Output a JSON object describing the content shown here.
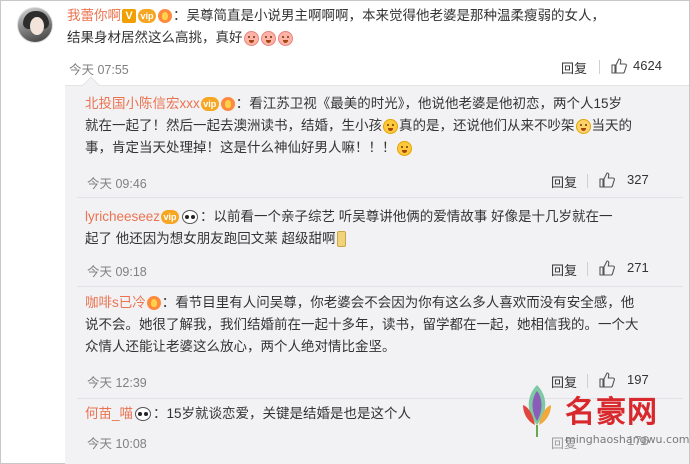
{
  "comments": [
    {
      "username": "我蕾你啊",
      "text_line1": "：吴尊简直是小说男主啊啊啊，本来觉得他老婆是那种温柔瘦弱的女人，",
      "text_line2": "结果身材居然这么高挑，真好",
      "time": "今天 07:55",
      "reply_label": "回复",
      "like_count": "4624"
    },
    {
      "username": "北投国小陈信宏xxx",
      "text_line1": "：看江苏卫视《最美的时光》，他说他老婆是他初恋，两个人15岁",
      "text_line2a": "就在一起了！然后一起去澳洲读书，结婚，生小孩",
      "text_line2b": "真的是，还说他们从来不吵架",
      "text_line2c": "当天的",
      "text_line3": "事，肯定当天处理掉！这是什么神仙好男人嘛！！！",
      "time": "今天 09:46",
      "reply_label": "回复",
      "like_count": "327"
    },
    {
      "username": "lyricheeseez",
      "text_line1": "：以前看一个亲子综艺  听吴尊讲他俩的爱情故事   好像是十几岁就在一",
      "text_line2": "起了   他还因为想女朋友跑回文莱   超级甜啊",
      "time": "今天 09:18",
      "reply_label": "回复",
      "like_count": "271"
    },
    {
      "username": "咖啡s已冷",
      "text_line1": "：看节目里有人问吴尊，你老婆会不会因为你有这么多人喜欢而没有安全感，他",
      "text_line2": "说不会。她很了解我，我们结婚前在一起十多年，读书，留学都在一起，她相信我的。一个大",
      "text_line3": "众情人还能让老婆这么放心，两个人绝对情比金坚。",
      "time": "今天 12:39",
      "reply_label": "回复",
      "like_count": "197"
    },
    {
      "username": "何苗_喵",
      "text_line1": "：15岁就谈恋爱，关键是结婚是也是这个人",
      "time": "今天 10:08",
      "reply_label": "回复",
      "like_count": "176"
    }
  ],
  "watermark": {
    "title": "名豪网",
    "url": "minghaoshangwu.com"
  },
  "colors": {
    "username": "#eb7350",
    "time": "#808080",
    "panel_bg": "#f2f2f5",
    "watermark_red": "#d9282c"
  }
}
